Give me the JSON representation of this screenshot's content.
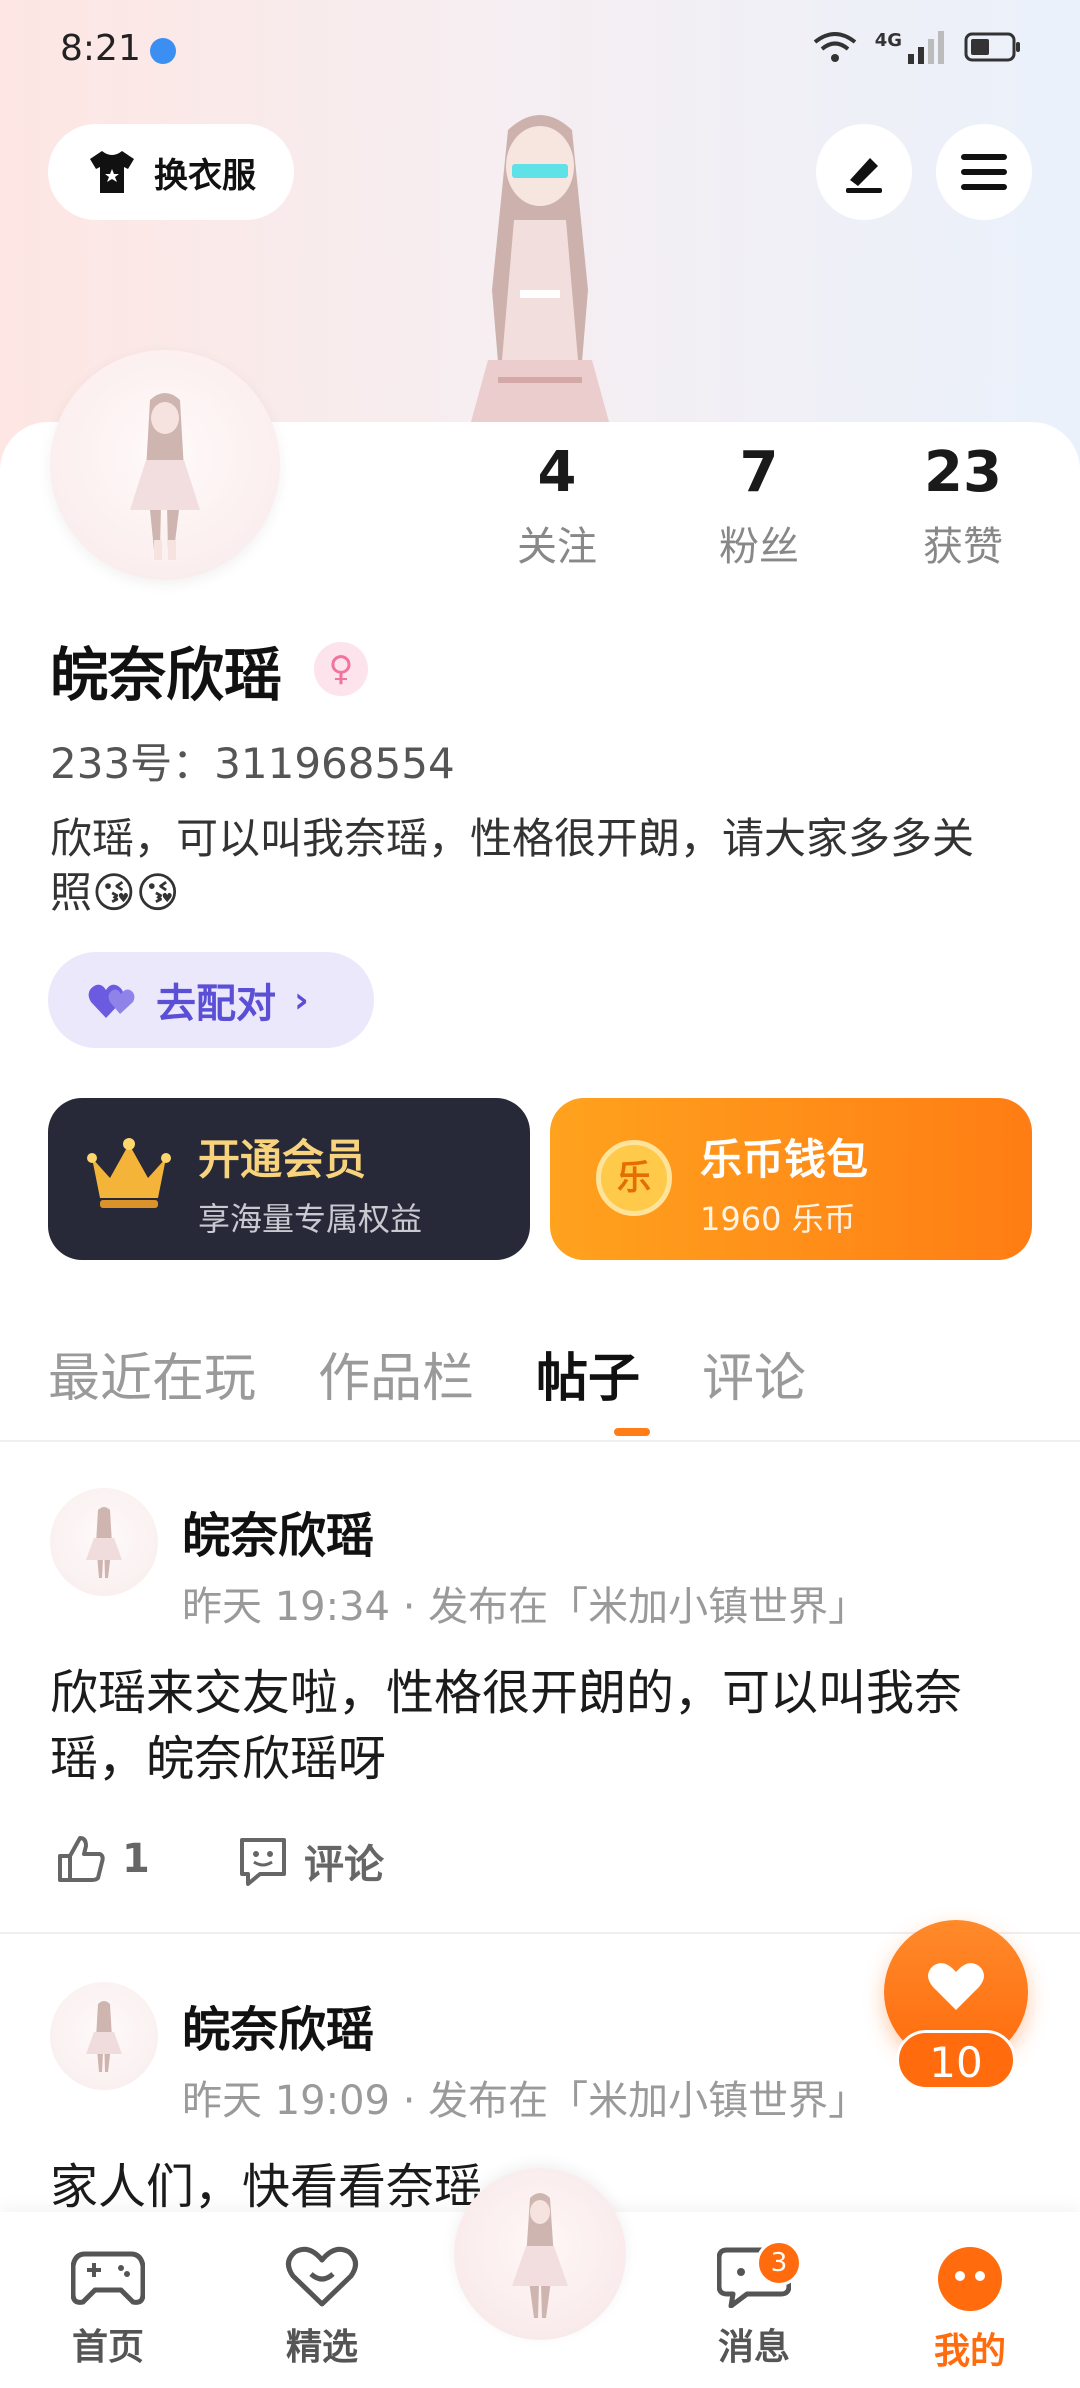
{
  "status_bar": {
    "time": "8:21",
    "network": "4G"
  },
  "header": {
    "outfit_button": "换衣服"
  },
  "stats": [
    {
      "value": "4",
      "label": "关注"
    },
    {
      "value": "7",
      "label": "粉丝"
    },
    {
      "value": "23",
      "label": "获赞"
    }
  ],
  "profile": {
    "name": "皖奈欣瑶",
    "gender_symbol": "♀",
    "id_line": "233号：311968554",
    "bio": "欣瑶，可以叫我奈瑶，性格很开朗，请大家多多关照😘😘",
    "match_button": "去配对"
  },
  "vip": {
    "title": "开通会员",
    "subtitle": "享海量专属权益"
  },
  "wallet": {
    "icon_char": "乐",
    "title": "乐币钱包",
    "subtitle": "1960 乐币"
  },
  "tabs": [
    "最近在玩",
    "作品栏",
    "帖子",
    "评论"
  ],
  "active_tab": 2,
  "posts": [
    {
      "author": "皖奈欣瑶",
      "meta": "昨天 19:34 · 发布在「米加小镇世界」",
      "body": "欣瑶来交友啦，性格很开朗的，可以叫我奈瑶，皖奈欣瑶呀",
      "likes": "1",
      "comment_label": "评论"
    },
    {
      "author": "皖奈欣瑶",
      "meta": "昨天 19:09 · 发布在「米加小镇世界」",
      "body": "家人们，快看看奈瑶"
    }
  ],
  "float_like": {
    "count": "10"
  },
  "bottom_nav": [
    {
      "label": "首页",
      "icon": "gamepad-icon"
    },
    {
      "label": "精选",
      "icon": "heart-outline-icon"
    },
    {
      "label": "消息",
      "icon": "chat-icon",
      "badge": "3"
    },
    {
      "label": "我的",
      "icon": "face-icon"
    }
  ],
  "colors": {
    "accent": "#ff6b0d",
    "vip_bg": "#272838",
    "match_text": "#5b4fd6"
  }
}
